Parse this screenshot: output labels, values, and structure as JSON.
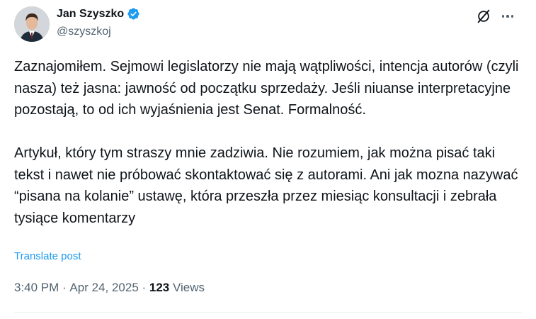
{
  "author": {
    "display_name": "Jan Szyszko",
    "handle": "@szyszkoj",
    "verified": true,
    "verified_color": "#1d9bf0"
  },
  "post": {
    "paragraphs": [
      "Zaznajomiłem. Sejmowi legislatorzy nie mają wątpliwości, intencja autorów (czyli nasza) też jasna: jawność od początku sprzedaży. Jeśli niuanse interpretacyjne pozostają, to od ich wyjaśnienia jest Senat. Formalność.",
      "Artykuł, który tym straszy mnie zadziwia. Nie rozumiem, jak można pisać taki tekst i nawet nie próbować skontaktować się z autorami. Ani jak mozna nazywać “pisana na kolanie” ustawę, która przeszła przez miesiąc konsultacji i zebrała tysiące komentarzy"
    ],
    "translate_label": "Translate post"
  },
  "meta": {
    "time": "3:40 PM",
    "separator": " · ",
    "date": "Apr 24, 2025",
    "views_count": "123",
    "views_label": " Views"
  },
  "icons": {
    "grok": "grok-icon",
    "more": "more-icon",
    "verified": "verified-badge-icon"
  }
}
